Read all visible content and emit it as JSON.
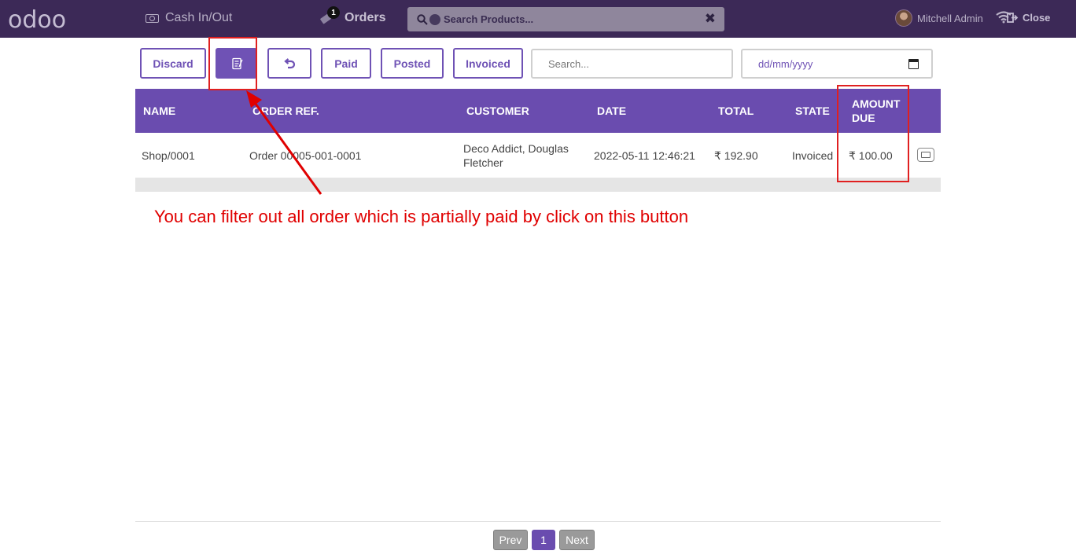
{
  "topbar": {
    "logo": "odoo",
    "cash_label": "Cash In/Out",
    "orders_label": "Orders",
    "orders_badge": "1",
    "search_placeholder": "Search Products...",
    "user_name": "Mitchell Admin",
    "close_label": "Close"
  },
  "controls": {
    "discard_label": "Discard",
    "paid_label": "Paid",
    "posted_label": "Posted",
    "invoiced_label": "Invoiced",
    "search_placeholder": "Search...",
    "date_placeholder": "dd/mm/yyyy"
  },
  "table": {
    "headers": [
      "NAME",
      "ORDER REF.",
      "CUSTOMER",
      "DATE",
      "TOTAL",
      "STATE",
      "AMOUNT DUE"
    ],
    "rows": [
      {
        "name": "Shop/0001",
        "order_ref": "Order 00005-001-0001",
        "customer": "Deco Addict, Douglas Fletcher",
        "date": "2022-05-11 12:46:21",
        "total": "₹ 192.90",
        "state": "Invoiced",
        "amount_due": "₹ 100.00"
      }
    ]
  },
  "annotation": {
    "text": "You can filter out all order which is partially paid by click on this button"
  },
  "pagination": {
    "prev_label": "Prev",
    "current_page": "1",
    "next_label": "Next"
  },
  "colors": {
    "topbar": "#3c2957",
    "accent": "#6a4caf",
    "annotation": "#e00000"
  }
}
